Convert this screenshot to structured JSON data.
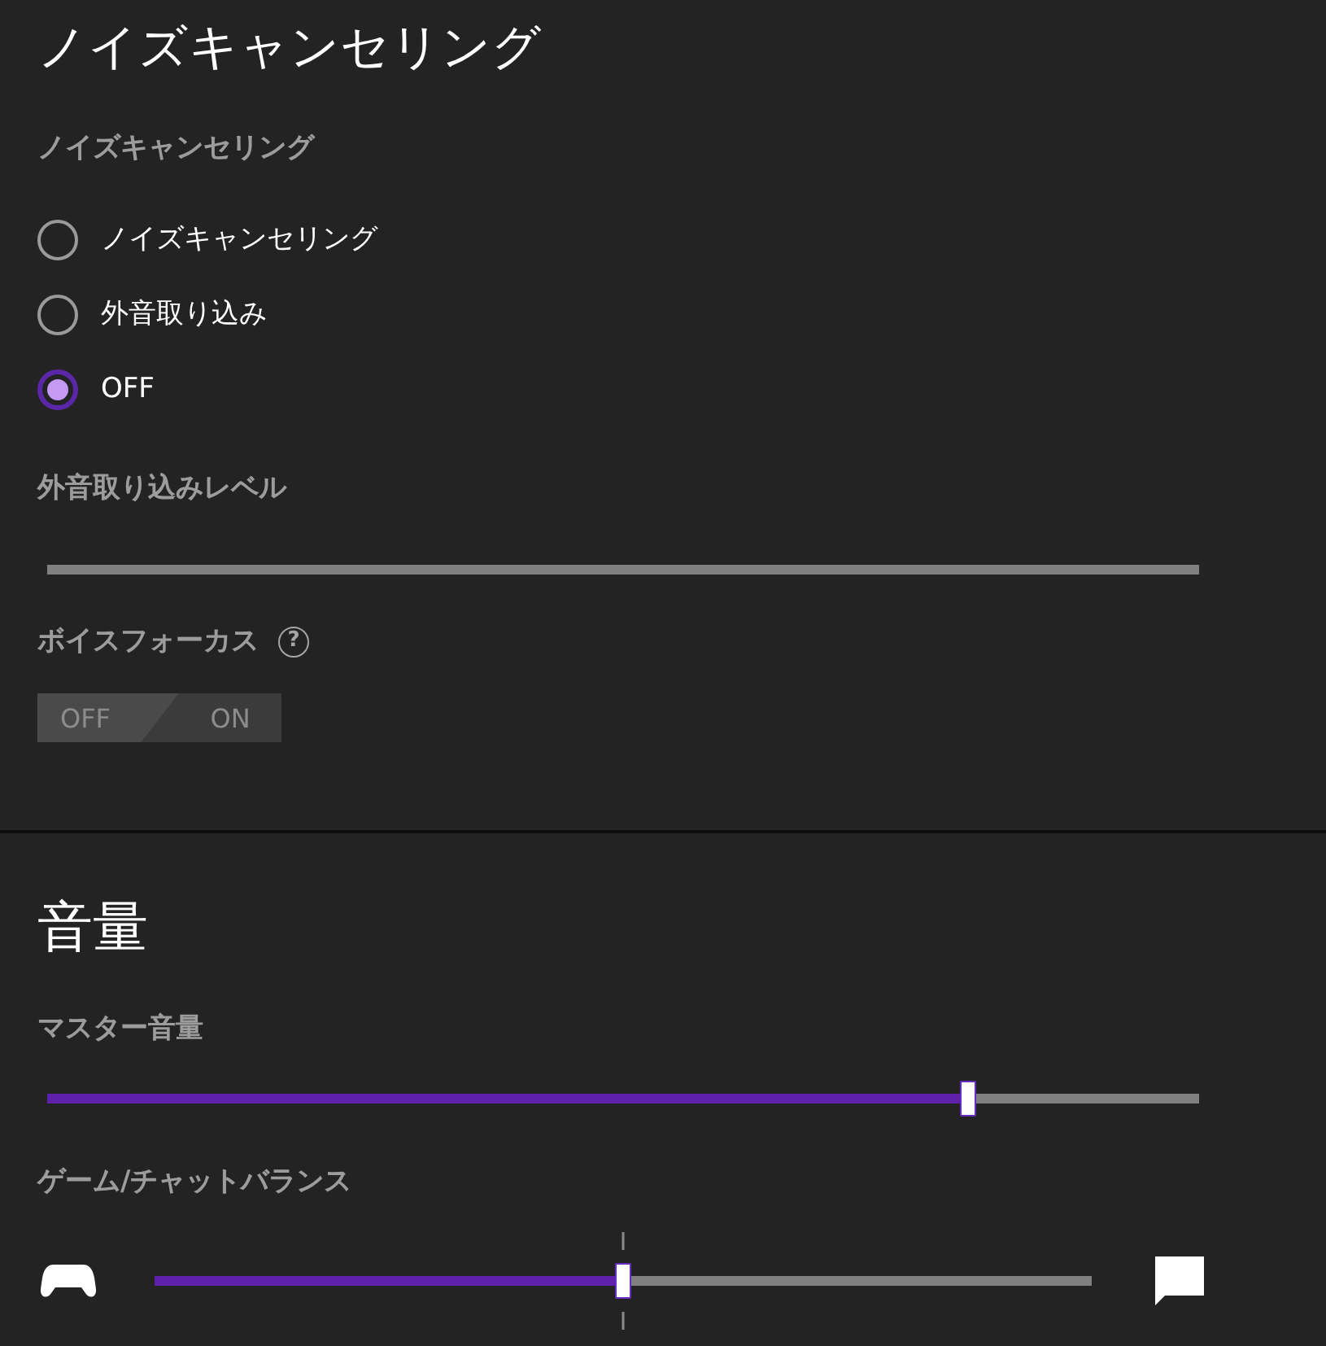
{
  "noise_cancelling": {
    "title": "ノイズキャンセリング",
    "label": "ノイズキャンセリング",
    "options": [
      {
        "label": "ノイズキャンセリング",
        "selected": false
      },
      {
        "label": "外音取り込み",
        "selected": false
      },
      {
        "label": "OFF",
        "selected": true
      }
    ]
  },
  "ambient_level": {
    "label": "外音取り込みレベル",
    "disabled": true
  },
  "voice_focus": {
    "label": "ボイスフォーカス",
    "help": "?",
    "toggle": [
      {
        "label": "OFF",
        "selected": true
      },
      {
        "label": "ON",
        "selected": false
      }
    ]
  },
  "volume": {
    "title": "音量",
    "master": {
      "label": "マスター音量",
      "level": 0.8
    },
    "balance": {
      "label": "ゲーム/チャットバランス",
      "level": 0.5
    }
  }
}
